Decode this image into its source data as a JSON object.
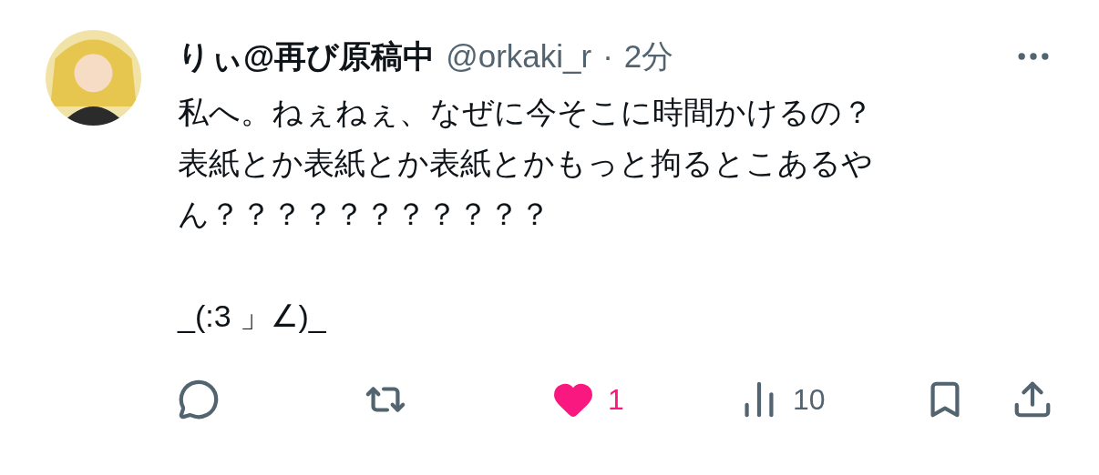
{
  "post": {
    "author_name": "りぃ@再び原稿中",
    "handle": "@orkaki_r",
    "separator": "·",
    "time": "2分",
    "paragraphs": [
      "私へ。ねぇねぇ、なぜに今そこに時間かけるの？表紙とか表紙とか表紙とかもっと拘るとこあるやん？？？？？？？？？？？",
      "_(:3 」∠)_"
    ]
  },
  "actions": [
    {
      "kind": "reply"
    },
    {
      "kind": "repost"
    },
    {
      "kind": "like",
      "count": "1",
      "selected": true
    },
    {
      "kind": "views",
      "count": "10"
    },
    {
      "kind": "bookmark"
    },
    {
      "kind": "share"
    }
  ]
}
